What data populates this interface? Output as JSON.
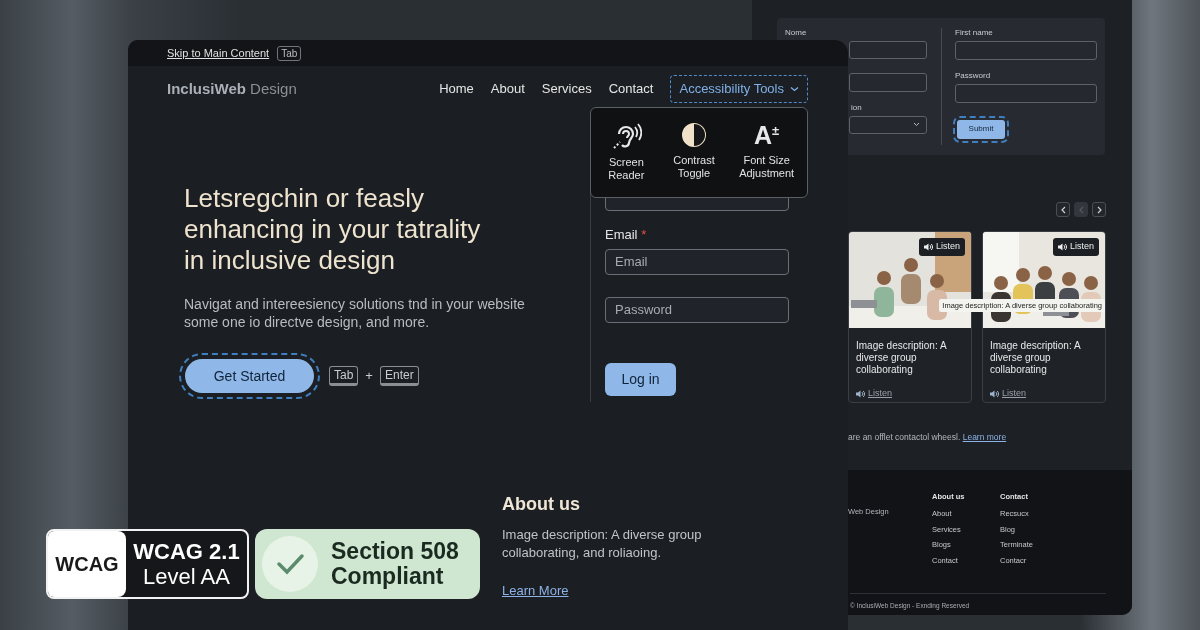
{
  "back_window": {
    "form": {
      "left_fields": [
        {
          "kind": "text",
          "label": "Nome"
        },
        {
          "kind": "text"
        },
        {
          "kind": "select",
          "label": "ion"
        }
      ],
      "right_fields": [
        {
          "label": "First name"
        },
        {
          "label": "Password"
        }
      ],
      "submit": {
        "label": "Submit",
        "focused": true
      }
    },
    "carousel": [
      {
        "kind": "prev",
        "disabled": false
      },
      {
        "kind": "middle",
        "disabled": true
      },
      {
        "kind": "next",
        "disabled": false
      }
    ],
    "cards": [
      {
        "badge": "Listen",
        "title": "Image description: A diverse group collaborating",
        "listen": "Listen"
      },
      {
        "badge": "Listen",
        "title": "Image description: A diverse group collaborating",
        "listen": "Listen",
        "tooltip": "Image description: A diverse group collaborating"
      }
    ],
    "note": {
      "text": "are an offlet contactol wheesl.",
      "link": "Learn more"
    },
    "footer": {
      "brand": "Web Design",
      "columns": [
        {
          "heading": "About us",
          "links": [
            "About",
            "Services",
            "Blogs",
            "Contact"
          ]
        },
        {
          "heading": "Contact",
          "links": [
            "Recsucx",
            "Blog",
            "Terminate",
            "Contacr"
          ]
        }
      ],
      "copyright": "© InclusiWeb Design - Exnding Reserved"
    }
  },
  "front_window": {
    "skip_link": "Skip to Main Content",
    "skip_key": "Tab",
    "logo": {
      "bold": "InclusiWeb",
      "light": "Design"
    },
    "nav": [
      {
        "label": "Home"
      },
      {
        "label": "About"
      },
      {
        "label": "Services"
      },
      {
        "label": "Contact"
      }
    ],
    "tools": {
      "label": "Accessibility Tools",
      "expanded": true,
      "focused": true,
      "items": [
        {
          "kind": "hearing",
          "label": "Screen Reader"
        },
        {
          "kind": "contrast",
          "label": "Contrast Toggle"
        },
        {
          "kind": "font-size",
          "symbol": "A$^{±}$",
          "label": "Font Size Adjustment"
        }
      ]
    },
    "hero": {
      "title": "Letsregchin or feasly\nenhancing in your tatrality\nin inclusive design",
      "text": "Navigat and intereesiency solutions tnd in your website\nsome one io directve design, and more.",
      "button": {
        "label": "Get Started",
        "focused": true
      },
      "keys": [
        "Tab",
        "Enter"
      ],
      "joiner": "+"
    },
    "login": {
      "fields": [
        {
          "kind": "name"
        },
        {
          "kind": "email",
          "label": "Email",
          "required_mark": "*",
          "placeholder": "Email"
        },
        {
          "kind": "password",
          "placeholder": "Password"
        }
      ],
      "button": "Log in"
    },
    "about": {
      "heading": "About us",
      "text": " Image description: A diverse group collaborating, and roliaoing.",
      "link": "Learn More"
    }
  },
  "badges": [
    {
      "kind": "wcag",
      "tag": "WCAG",
      "title": "WCAG 2.1",
      "subtitle": "Level AA"
    },
    {
      "kind": "section508",
      "title": "Section 508",
      "subtitle": "Compliant"
    }
  ]
}
